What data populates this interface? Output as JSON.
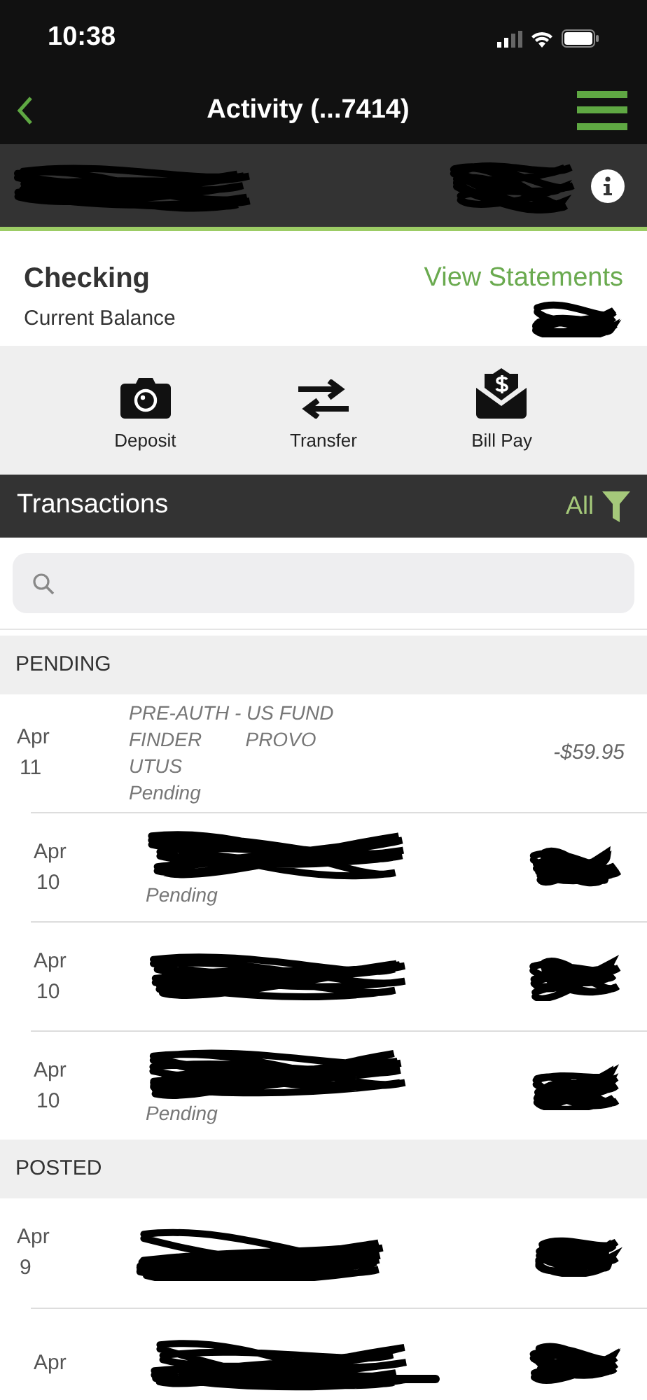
{
  "status_bar": {
    "time": "10:38"
  },
  "nav": {
    "title": "Activity (...7414)"
  },
  "balance_bar": {
    "redacted": true
  },
  "account": {
    "name": "Checking",
    "balance_label": "Current Balance",
    "balance_redacted": true,
    "link": "View Statements"
  },
  "actions": [
    {
      "kind": "camera",
      "label": "Deposit"
    },
    {
      "kind": "transfer",
      "label": "Transfer"
    },
    {
      "kind": "bill",
      "label": "Bill Pay"
    }
  ],
  "transactions_header": {
    "title": "Transactions",
    "filter": "All"
  },
  "sections": [
    {
      "title": "PENDING",
      "rows": [
        {
          "month": "Apr",
          "day": "11",
          "description": "PRE-AUTH - US FUND\nFINDER        PROVO\nUTUS",
          "status": "Pending",
          "amount": "-$59.95",
          "redacted": false
        },
        {
          "month": "Apr",
          "day": "10",
          "status": "Pending",
          "redacted": true
        },
        {
          "month": "Apr",
          "day": "10",
          "redacted": true
        },
        {
          "month": "Apr",
          "day": "10",
          "status": "Pending",
          "redacted": true
        }
      ]
    },
    {
      "title": "POSTED",
      "rows": [
        {
          "month": "Apr",
          "day": "9",
          "redacted": true
        },
        {
          "month": "Apr",
          "redacted": true
        }
      ]
    }
  ]
}
